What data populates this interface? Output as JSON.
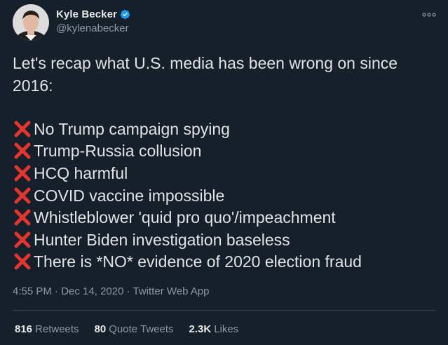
{
  "author": {
    "display_name": "Kyle Becker",
    "handle": "@kylenabecker"
  },
  "tweet": {
    "intro": "Let's recap what U.S. media has been wrong on since 2016:",
    "items": [
      "No Trump campaign spying",
      "Trump-Russia collusion",
      "HCQ harmful",
      "COVID vaccine impossible",
      "Whistleblower 'quid pro quo'/impeachment",
      "Hunter Biden investigation baseless",
      "There is *NO* evidence of 2020 election fraud"
    ],
    "item_icon": "cross-mark-icon"
  },
  "meta": {
    "time": "4:55 PM",
    "date": "Dec 14, 2020",
    "source": "Twitter Web App"
  },
  "stats": {
    "retweets_count": "816",
    "retweets_label": "Retweets",
    "quotes_count": "80",
    "quotes_label": "Quote Tweets",
    "likes_count": "2.3K",
    "likes_label": "Likes"
  },
  "colors": {
    "background": "#15202b",
    "text": "#e1e4e6",
    "secondary": "#8b98a5",
    "cross": "#e3352d",
    "verified": "#1d9bf0"
  },
  "icons": {
    "verified": "verified-badge-icon",
    "more": "more-options-icon"
  }
}
